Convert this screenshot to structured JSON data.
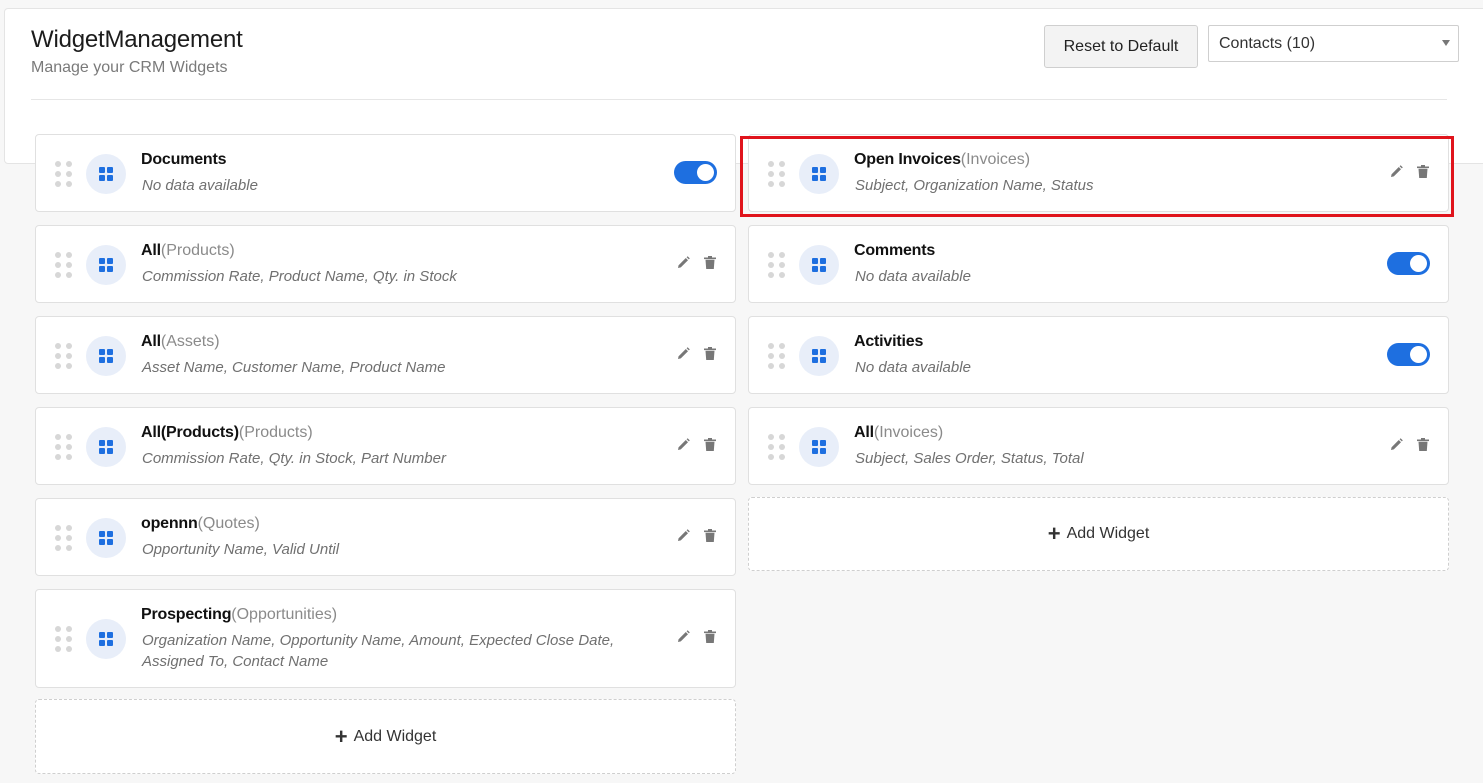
{
  "header": {
    "title": "WidgetManagement",
    "subtitle": "Manage your CRM Widgets",
    "reset_label": "Reset to Default",
    "module_select_value": "Contacts (10)"
  },
  "left_widgets": [
    {
      "name": "Documents",
      "module": "",
      "fields": "No data available",
      "control": "toggle",
      "enabled": true
    },
    {
      "name": "All",
      "module": "(Products)",
      "fields": "Commission Rate, Product Name, Qty. in Stock",
      "control": "actions"
    },
    {
      "name": "All",
      "module": "(Assets)",
      "fields": "Asset Name, Customer Name, Product Name",
      "control": "actions"
    },
    {
      "name": "All(Products)",
      "module": "(Products)",
      "fields": "Commission Rate, Qty. in Stock, Part Number",
      "control": "actions"
    },
    {
      "name": "opennn",
      "module": "(Quotes)",
      "fields": "Opportunity Name, Valid Until",
      "control": "actions"
    },
    {
      "name": "Prospecting",
      "module": "(Opportunities)",
      "fields": "Organization Name, Opportunity Name, Amount, Expected Close Date, Assigned To, Contact Name",
      "control": "actions"
    }
  ],
  "right_widgets": [
    {
      "name": "Open Invoices",
      "module": "(Invoices)",
      "fields": "Subject, Organization Name, Status",
      "control": "actions"
    },
    {
      "name": "Comments",
      "module": "",
      "fields": "No data available",
      "control": "toggle",
      "enabled": true
    },
    {
      "name": "Activities",
      "module": "",
      "fields": "No data available",
      "control": "toggle",
      "enabled": true
    },
    {
      "name": "All",
      "module": "(Invoices)",
      "fields": "Subject, Sales Order, Status, Total",
      "control": "actions"
    }
  ],
  "add_widget_label": "Add Widget",
  "colors": {
    "accent": "#1e6fe0",
    "highlight": "#e0141c"
  },
  "icons": {
    "widget": "grid-icon",
    "edit": "pencil-icon",
    "delete": "trash-icon",
    "drag": "drag-handle-icon",
    "add": "plus-icon"
  }
}
